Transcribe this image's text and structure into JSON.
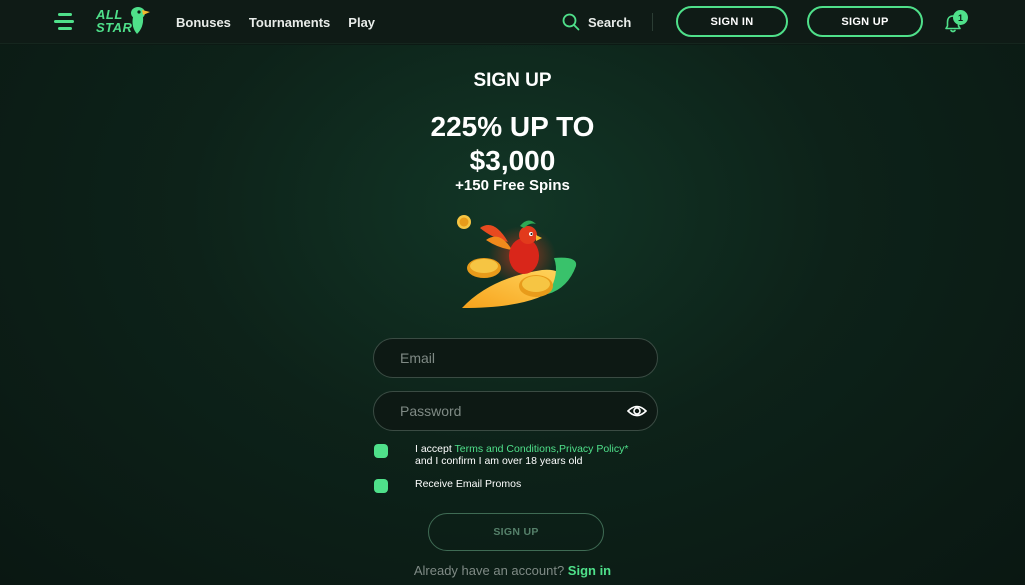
{
  "brand": {
    "line1": "ALL",
    "line2": "STAR"
  },
  "nav": {
    "items": [
      {
        "label": "Bonuses"
      },
      {
        "label": "Tournaments"
      },
      {
        "label": "Play"
      }
    ]
  },
  "header": {
    "search_label": "Search",
    "sign_in_label": "SIGN IN",
    "sign_up_label": "SIGN UP",
    "notification_count": "1"
  },
  "signup": {
    "title": "SIGN UP",
    "promo_line1": "225% UP TO",
    "promo_line2": "$3,000",
    "promo_line3": "+150 Free Spins",
    "email_placeholder": "Email",
    "password_placeholder": "Password",
    "terms_prefix": "I accept ",
    "terms_link": "Terms and Conditions",
    "privacy_link": ",Privacy Policy*",
    "terms_suffix": "and I confirm I am over 18 years old",
    "promos_label": "Receive Email Promos",
    "submit_label": "SIGN UP",
    "footer_text": "Already have an account?",
    "footer_link": "Sign in"
  },
  "colors": {
    "accent": "#4fe08a",
    "background": "#0c1a14",
    "header": "#0f1b16"
  },
  "icons": [
    "menu-icon",
    "logo-parrot-icon",
    "search-icon",
    "bell-icon",
    "eye-icon",
    "parrot-surfboard-illustration"
  ]
}
